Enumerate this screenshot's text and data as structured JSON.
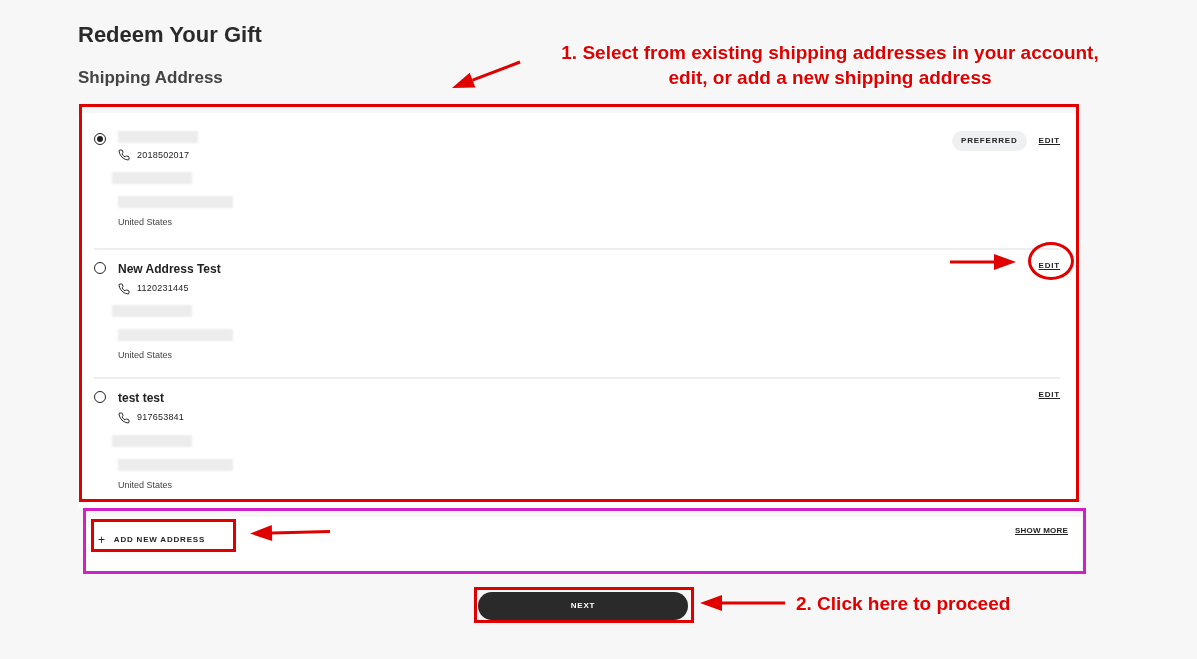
{
  "page": {
    "title": "Redeem Your Gift",
    "section": "Shipping Address"
  },
  "addresses": [
    {
      "phone": "2018502017",
      "country": "United States",
      "selected": true,
      "preferred": true,
      "badge": "PREFERRED",
      "edit": "EDIT"
    },
    {
      "name": "New Address Test",
      "phone": "1120231445",
      "country": "United States",
      "selected": false,
      "preferred": false,
      "edit": "EDIT"
    },
    {
      "name": "test test",
      "phone": "917653841",
      "country": "United States",
      "selected": false,
      "preferred": false,
      "edit": "EDIT"
    }
  ],
  "add_address": {
    "icon": "+",
    "label": "ADD NEW ADDRESS"
  },
  "show_more": "SHOW MORE",
  "next_button": "NEXT",
  "annotations": [
    "1. Select from existing shipping addresses in your account, edit, or add a new shipping address",
    "2. Click here to proceed"
  ]
}
